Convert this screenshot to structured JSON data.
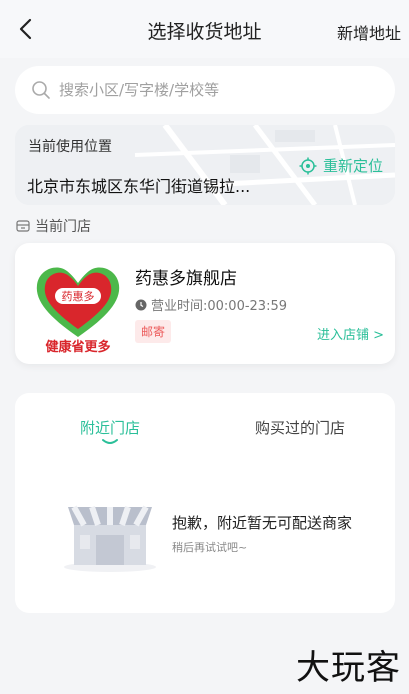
{
  "header": {
    "title": "选择收货地址",
    "add_address_label": "新增地址"
  },
  "search": {
    "placeholder": "搜索小区/写字楼/学校等"
  },
  "current_location": {
    "label": "当前使用位置",
    "address": "北京市东城区东华门街道锡拉...",
    "relocate_label": "重新定位"
  },
  "current_store_section": {
    "title": "当前门店"
  },
  "store": {
    "name": "药惠多旗舰店",
    "hours": "营业时间:00:00-23:59",
    "tag": "邮寄",
    "enter_label": "进入店铺 >",
    "logo_badge_text": "药惠多",
    "logo_slogan": "健康省更多"
  },
  "tabs": {
    "nearby": "附近门店",
    "purchased": "购买过的门店"
  },
  "empty_state": {
    "title": "抱歉，附近暂无可配送商家",
    "subtitle": "稍后再试试吧~"
  },
  "watermark": "大玩客",
  "colors": {
    "accent": "#2bbf99",
    "tag_red": "#ec5a5a",
    "logo_red": "#d9262c",
    "logo_green": "#4cb84a"
  }
}
